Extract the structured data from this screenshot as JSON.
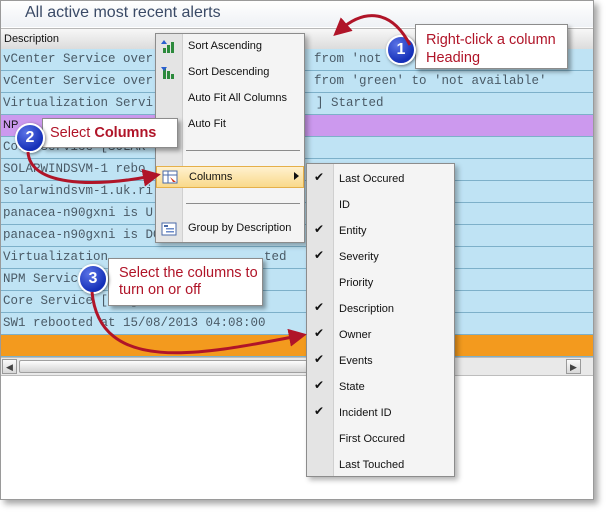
{
  "window": {
    "title": "All active most recent alerts"
  },
  "column_header": "Description",
  "rows": [
    {
      "text": "vCenter Service over",
      "tail": "from 'not",
      "color": "#bfe3f4"
    },
    {
      "text": "vCenter Service over",
      "tail": "from 'green' to 'not available'",
      "color": "#bfe3f4"
    },
    {
      "text": "Virtualization Servi",
      "tail": "] Started",
      "color": "#bfe3f4"
    },
    {
      "text": "NP",
      "tail": "",
      "color": "#cc99ee"
    },
    {
      "text": "Core Service [SOLAR",
      "tail": "",
      "color": "#bfe3f4"
    },
    {
      "text": "SOLARWINDSVM-1 rebo",
      "tail": "",
      "color": "#bfe3f4"
    },
    {
      "text": "solarwindsvm-1.uk.ri",
      "tail": "",
      "color": "#bfe3f4"
    },
    {
      "text": "panacea-n90gxni is U",
      "tail": "",
      "color": "#bfe3f4"
    },
    {
      "text": "panacea-n90gxni is DOWN!",
      "tail": "",
      "color": "#bfe3f4"
    },
    {
      "text": "Virtualization",
      "tail": "ted",
      "color": "#bfe3f4"
    },
    {
      "text": "NPM Service",
      "tail": "",
      "color": "#bfe3f4"
    },
    {
      "text": "Core Service [SW1] Started",
      "tail": "",
      "color": "#bfe3f4"
    },
    {
      "text": "SW1 rebooted at 15/08/2013 04:08:00",
      "tail": "",
      "color": "#bfe3f4"
    },
    {
      "text": "",
      "tail": "",
      "color": "#f39a1e"
    }
  ],
  "context_menu": {
    "sort_ascending": "Sort Ascending",
    "sort_descending": "Sort Descending",
    "auto_fit_all": "Auto Fit All Columns",
    "auto_fit": "Auto Fit",
    "columns": "Columns",
    "group_by": "Group by Description"
  },
  "columns_submenu": [
    {
      "label": "Last Occured",
      "checked": true
    },
    {
      "label": "ID",
      "checked": false
    },
    {
      "label": "Entity",
      "checked": true
    },
    {
      "label": "Severity",
      "checked": true
    },
    {
      "label": "Priority",
      "checked": false
    },
    {
      "label": "Description",
      "checked": true
    },
    {
      "label": "Owner",
      "checked": true
    },
    {
      "label": "Events",
      "checked": true
    },
    {
      "label": "State",
      "checked": true
    },
    {
      "label": "Incident ID",
      "checked": true
    },
    {
      "label": "First Occured",
      "checked": false
    },
    {
      "label": "Last Touched",
      "checked": false
    }
  ],
  "callouts": {
    "step1": {
      "number": "1",
      "text": "Right-click a column Heading"
    },
    "step2": {
      "number": "2",
      "prefix": "Select ",
      "bold": "Columns"
    },
    "step3": {
      "number": "3",
      "text": "Select the columns to turn on or off"
    }
  },
  "colors": {
    "accent_red": "#b01428",
    "badge_blue": "#1530b8",
    "row_blue": "#bfe3f4",
    "row_purple": "#cc99ee",
    "row_orange": "#f39a1e"
  }
}
